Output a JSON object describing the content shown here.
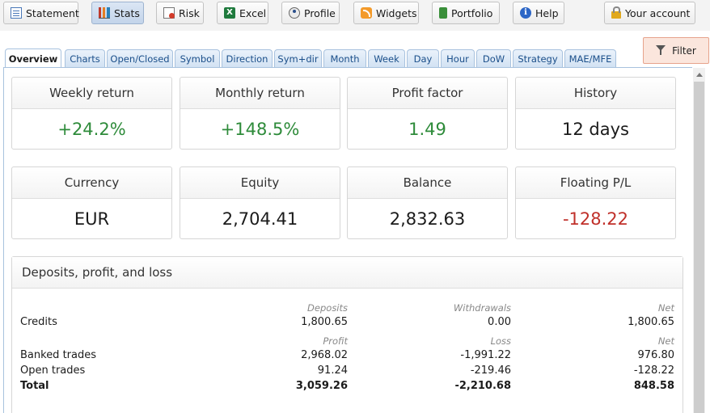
{
  "toolbar": {
    "buttons": [
      {
        "label": "Statement",
        "icon": "statement-icon"
      },
      {
        "label": "Stats",
        "icon": "stats-icon"
      },
      {
        "label": "Risk",
        "icon": "risk-icon"
      },
      {
        "label": "Excel",
        "icon": "excel-icon"
      },
      {
        "label": "Profile",
        "icon": "profile-icon"
      },
      {
        "label": "Widgets",
        "icon": "widgets-icon"
      },
      {
        "label": "Portfolio",
        "icon": "portfolio-icon"
      },
      {
        "label": "Help",
        "icon": "help-icon"
      }
    ],
    "account_label": "Your account",
    "excel_glyph": "X",
    "help_glyph": "i"
  },
  "tabs": [
    {
      "label": "Overview",
      "active": true
    },
    {
      "label": "Charts"
    },
    {
      "label": "Open/Closed"
    },
    {
      "label": "Symbol"
    },
    {
      "label": "Direction"
    },
    {
      "label": "Sym+dir"
    },
    {
      "label": "Month"
    },
    {
      "label": "Week"
    },
    {
      "label": "Day"
    },
    {
      "label": "Hour"
    },
    {
      "label": "DoW"
    },
    {
      "label": "Strategy"
    },
    {
      "label": "MAE/MFE"
    }
  ],
  "filter_label": "Filter",
  "cards": [
    {
      "title": "Weekly return",
      "value": "+24.2%",
      "tone": "positive"
    },
    {
      "title": "Monthly return",
      "value": "+148.5%",
      "tone": "positive"
    },
    {
      "title": "Profit factor",
      "value": "1.49",
      "tone": "positive"
    },
    {
      "title": "History",
      "value": "12 days",
      "tone": "neutral"
    },
    {
      "title": "Currency",
      "value": "EUR",
      "tone": "neutral"
    },
    {
      "title": "Equity",
      "value": "2,704.41",
      "tone": "neutral"
    },
    {
      "title": "Balance",
      "value": "2,832.63",
      "tone": "neutral"
    },
    {
      "title": "Floating P/L",
      "value": "-128.22",
      "tone": "negative"
    }
  ],
  "deposits": {
    "title": "Deposits, profit, and loss",
    "header1": {
      "c1": "Deposits",
      "c2": "Withdrawals",
      "c3": "Net"
    },
    "credits": {
      "label": "Credits",
      "c1": "1,800.65",
      "c2": "0.00",
      "c3": "1,800.65"
    },
    "header2": {
      "c1": "Profit",
      "c2": "Loss",
      "c3": "Net"
    },
    "banked": {
      "label": "Banked trades",
      "c1": "2,968.02",
      "c2": "-1,991.22",
      "c3": "976.80"
    },
    "open": {
      "label": "Open trades",
      "c1": "91.24",
      "c2": "-219.46",
      "c3": "-128.22"
    },
    "total": {
      "label": "Total",
      "c1": "3,059.26",
      "c2": "-2,210.68",
      "c3": "848.58"
    }
  },
  "colors": {
    "positive": "#2e8b3a",
    "negative": "#c0302a",
    "tab_accent": "#1b4f8a",
    "filter_bg": "#fbe6dd"
  }
}
